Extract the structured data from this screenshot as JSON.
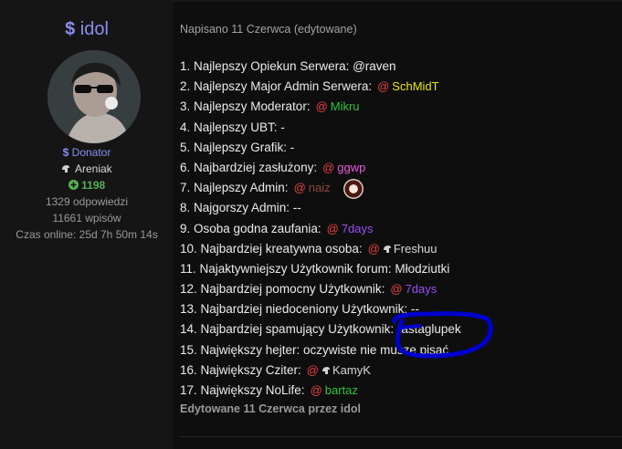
{
  "profile": {
    "username": "idol",
    "rank": "Donator",
    "title": "Areniak",
    "points": "1198",
    "replies": "1329 odpowiedzi",
    "posts": "11661 wpisów",
    "online": "Czas online: 25d 7h 50m 14s"
  },
  "post": {
    "posted": "Napisano 11 Czerwca (edytowane)",
    "edited": "Edytowane 11 Czerwca przez idol",
    "lines": [
      {
        "text": "1. Najlepszy Opiekun Serwera: @raven",
        "mention": "",
        "color": ""
      },
      {
        "text": "2. Najlepszy Major Admin Serwera:",
        "mention": "SchMidT",
        "color": "#e8e800"
      },
      {
        "text": "3. Najlepszy Moderator:",
        "mention": "Mikru",
        "color": "#33c23a"
      },
      {
        "text": "4. Najlepszy UBT: -",
        "mention": "",
        "color": ""
      },
      {
        "text": "5. Najlepszy Grafik: -",
        "mention": "",
        "color": ""
      },
      {
        "text": "6. Najbardziej zasłużony:",
        "mention": "ggwp",
        "color": "#e85ad8"
      },
      {
        "text": "7. Najlepszy Admin:",
        "mention": "naiz",
        "color": "#8c4a3e"
      },
      {
        "text": "8. Najgorszy Admin: --",
        "mention": "",
        "color": ""
      },
      {
        "text": "9. Osoba godna zaufania:",
        "mention": "7days",
        "color": "#9b4ff0"
      },
      {
        "text": "10. Najbardziej kreatywna osoba:",
        "mention": "Freshuu",
        "color": "#d8d8d8"
      },
      {
        "text": "11. Najaktywniejszy Użytkownik forum: Młodziutki",
        "mention": "",
        "color": ""
      },
      {
        "text": "12. Najbardziej pomocny Użytkownik:",
        "mention": "7days",
        "color": "#9b4ff0"
      },
      {
        "text": "13. Najbardziej niedoceniony Użytkownik: --",
        "mention": "",
        "color": ""
      },
      {
        "text": "14. Najbardziej spamujący Użytkownik: rastaglupek",
        "mention": "",
        "color": ""
      },
      {
        "text": "15. Największy hejter: oczywiste nie muszę pisać",
        "mention": "",
        "color": ""
      },
      {
        "text": "16. Największy Cziter:",
        "mention": "KamyK",
        "color": "#d8d8d8"
      },
      {
        "text": "17. Największy NoLife:",
        "mention": "bartaz",
        "color": "#33c23a"
      }
    ]
  },
  "colors": {
    "accent": "#8b8df0",
    "mention_at": "#e84040",
    "annotation": "#0000cc"
  },
  "icons": [
    "dollar-icon",
    "helmet-icon",
    "plus-circle-icon"
  ]
}
